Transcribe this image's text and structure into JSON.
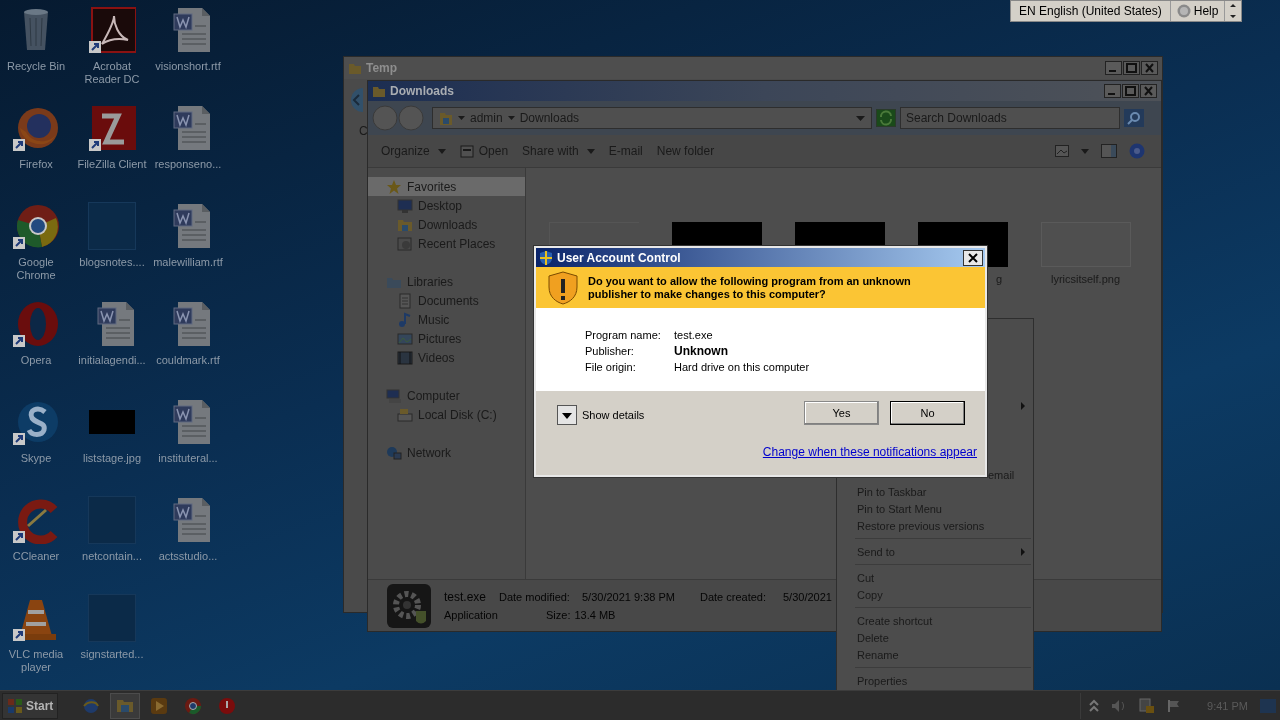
{
  "language_bar": {
    "language": "EN English (United States)",
    "help": "Help"
  },
  "desktop_icons": [
    {
      "label": "Recycle Bin",
      "kind": "bin",
      "shortcut": false
    },
    {
      "label": "Acrobat Reader DC",
      "kind": "pdf",
      "shortcut": true
    },
    {
      "label": "visionshort.rtf",
      "kind": "doc",
      "shortcut": false
    },
    {
      "label": "Firefox",
      "kind": "firefox",
      "shortcut": true
    },
    {
      "label": "FileZilla Client",
      "kind": "filezilla",
      "shortcut": true
    },
    {
      "label": "responseno...",
      "kind": "doc",
      "shortcut": false
    },
    {
      "label": "Google Chrome",
      "kind": "chrome",
      "shortcut": true
    },
    {
      "label": "blogsnotes....",
      "kind": "blank",
      "shortcut": false
    },
    {
      "label": "malewilliam.rtf",
      "kind": "doc",
      "shortcut": false
    },
    {
      "label": "Opera",
      "kind": "opera",
      "shortcut": true
    },
    {
      "label": "initialagendi...",
      "kind": "doc",
      "shortcut": false
    },
    {
      "label": "couldmark.rtf",
      "kind": "doc",
      "shortcut": false
    },
    {
      "label": "Skype",
      "kind": "skype",
      "shortcut": true
    },
    {
      "label": "liststage.jpg",
      "kind": "image",
      "shortcut": false
    },
    {
      "label": "instituteral...",
      "kind": "doc",
      "shortcut": false
    },
    {
      "label": "CCleaner",
      "kind": "ccleaner",
      "shortcut": true
    },
    {
      "label": "netcontain...",
      "kind": "blank",
      "shortcut": false
    },
    {
      "label": "actsstudio...",
      "kind": "doc",
      "shortcut": false
    },
    {
      "label": "VLC media player",
      "kind": "vlc",
      "shortcut": true
    },
    {
      "label": "signstarted...",
      "kind": "blank",
      "shortcut": false
    }
  ],
  "temp_window": {
    "title": "Temp",
    "fragment": "C"
  },
  "explorer": {
    "title": "Downloads",
    "breadcrumb": [
      "admin",
      "Downloads"
    ],
    "search": {
      "placeholder": "Search Downloads"
    },
    "toolbar": [
      {
        "label": "Organize",
        "kind": "menu"
      },
      {
        "label": "Open",
        "kind": "icon"
      },
      {
        "label": "Share with",
        "kind": "menu"
      },
      {
        "label": "E-mail",
        "kind": "plain"
      },
      {
        "label": "New folder",
        "kind": "plain"
      }
    ],
    "tree": [
      {
        "label": "Favorites",
        "kind": "star",
        "selected": true,
        "children": [
          {
            "label": "Desktop",
            "kind": "monitor",
            "selected": false
          },
          {
            "label": "Downloads",
            "kind": "folder",
            "selected": false
          },
          {
            "label": "Recent Places",
            "kind": "recent",
            "selected": false
          }
        ]
      },
      {
        "label": "Libraries",
        "kind": "library",
        "selected": false,
        "children": [
          {
            "label": "Documents",
            "kind": "document",
            "selected": false
          },
          {
            "label": "Music",
            "kind": "music",
            "selected": false
          },
          {
            "label": "Pictures",
            "kind": "picture",
            "selected": false
          },
          {
            "label": "Videos",
            "kind": "video",
            "selected": false
          }
        ]
      },
      {
        "label": "Computer",
        "kind": "computer",
        "selected": false,
        "children": [
          {
            "label": "Local Disk (C:)",
            "kind": "disk",
            "selected": false
          }
        ]
      },
      {
        "label": "Network",
        "kind": "network",
        "selected": false
      }
    ],
    "files": [
      {
        "kind": "blank"
      },
      {
        "kind": "dark"
      },
      {
        "kind": "dark"
      },
      {
        "kind": "dark",
        "label": "g"
      },
      {
        "kind": "light",
        "label": "lyricsitself.png"
      }
    ],
    "details": {
      "name": "test.exe",
      "type": "Application",
      "fields": [
        {
          "label": "Date modified:",
          "value": "5/30/2021 9:38 PM"
        },
        {
          "label": "Date created:",
          "value": "5/30/2021"
        },
        {
          "label": "Size:",
          "value": "13.4 MB"
        }
      ]
    }
  },
  "context_menu": {
    "items": [
      {
        "kind": "covered",
        "submenu": true
      },
      {
        "kind": "partial",
        "label": "email",
        "submenu": false
      },
      {
        "kind": "item",
        "label": "Pin to Taskbar",
        "submenu": false
      },
      {
        "kind": "item",
        "label": "Pin to Start Menu",
        "submenu": false
      },
      {
        "kind": "item",
        "label": "Restore previous versions",
        "submenu": false
      },
      {
        "kind": "separator"
      },
      {
        "kind": "item",
        "label": "Send to",
        "submenu": true
      },
      {
        "kind": "separator"
      },
      {
        "kind": "item",
        "label": "Cut",
        "submenu": false
      },
      {
        "kind": "item",
        "label": "Copy",
        "submenu": false
      },
      {
        "kind": "separator"
      },
      {
        "kind": "item",
        "label": "Create shortcut",
        "submenu": false
      },
      {
        "kind": "item",
        "label": "Delete",
        "submenu": false
      },
      {
        "kind": "item",
        "label": "Rename",
        "submenu": false
      },
      {
        "kind": "separator"
      },
      {
        "kind": "item",
        "label": "Properties",
        "submenu": false
      }
    ]
  },
  "uac": {
    "title": "User Account Control",
    "question": "Do you want to allow the following program from an unknown publisher to make changes to this computer?",
    "fields": [
      {
        "label": "Program name:",
        "value": "test.exe",
        "emphasis": false
      },
      {
        "label": "Publisher:",
        "value": "Unknown",
        "emphasis": true
      },
      {
        "label": "File origin:",
        "value": "Hard drive on this computer",
        "emphasis": false
      }
    ],
    "details_toggle": {
      "label": "Show details",
      "expanded": false
    },
    "buttons": [
      {
        "label": "Yes",
        "selected": false
      },
      {
        "label": "No",
        "selected": true
      }
    ],
    "link": "Change when these notifications appear"
  },
  "taskbar": {
    "start": "Start",
    "apps": [
      {
        "kind": "ie",
        "active": false
      },
      {
        "kind": "folder",
        "active": true
      },
      {
        "kind": "media",
        "active": false
      },
      {
        "kind": "chrome",
        "active": false
      },
      {
        "kind": "red",
        "active": false
      }
    ],
    "clock": "9:41 PM"
  }
}
